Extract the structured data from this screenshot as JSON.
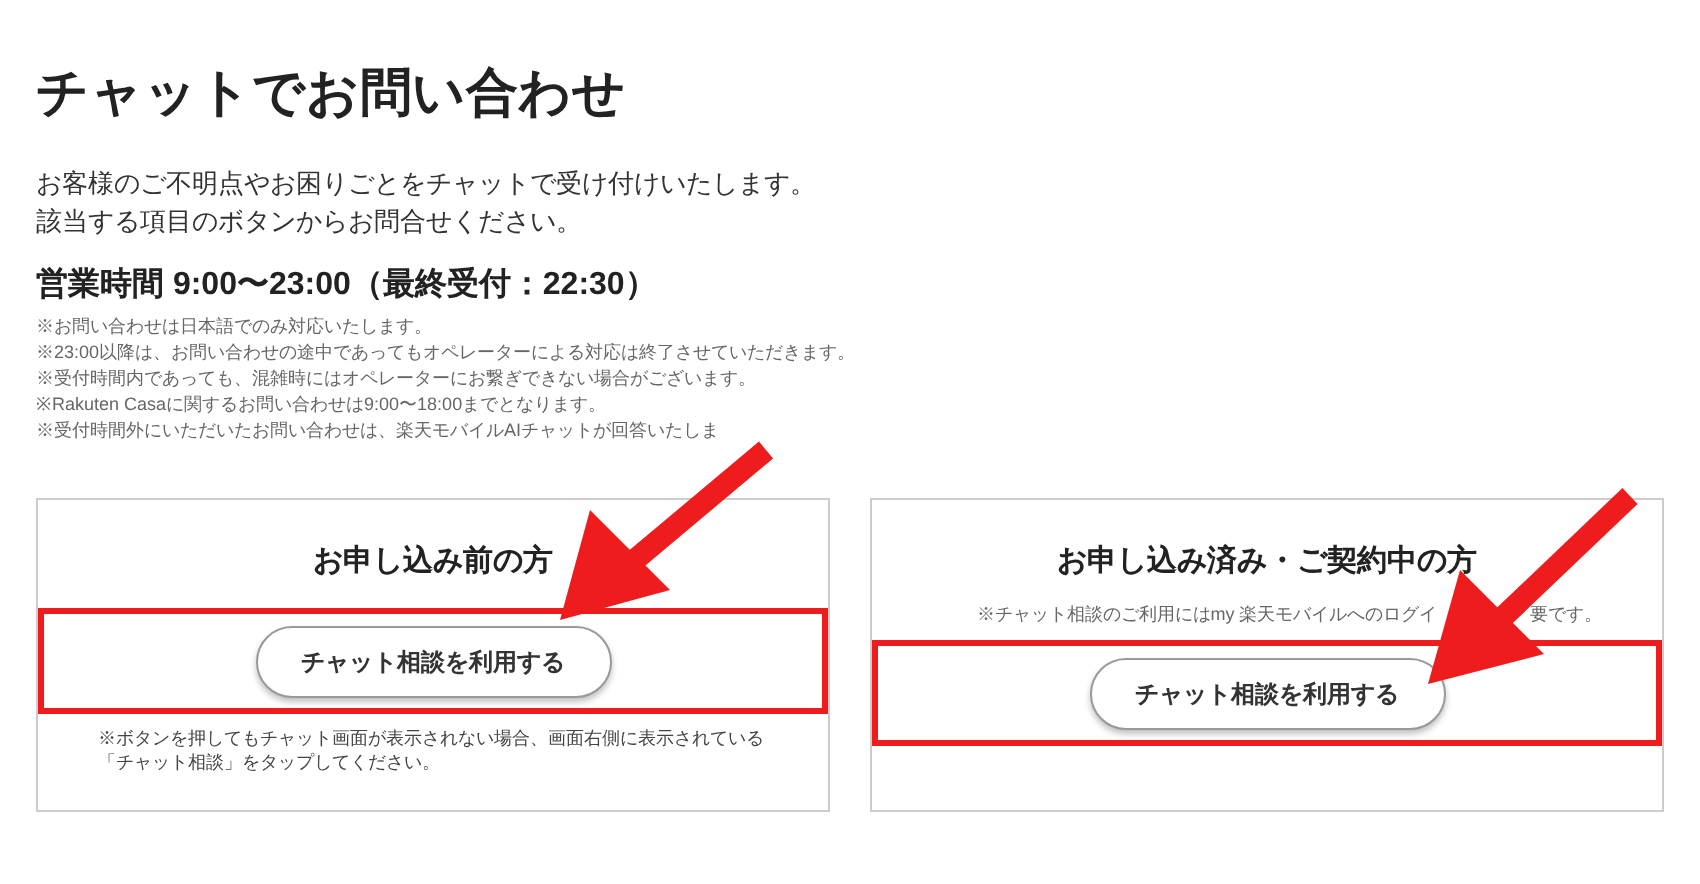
{
  "title": "チャットでお問い合わせ",
  "intro": [
    "お客様のご不明点やお困りごとをチャットで受け付けいたします。",
    "該当する項目のボタンからお問合せください。"
  ],
  "hours": "営業時間 9:00〜23:00（最終受付：22:30）",
  "notes": [
    "※お問い合わせは日本語でのみ対応いたします。",
    "※23:00以降は、お問い合わせの途中であってもオペレーターによる対応は終了させていただきます。",
    "※受付時間内であっても、混雑時にはオペレーターにお繋ぎできない場合がございます。",
    "※Rakuten Casaに関するお問い合わせは9:00〜18:00までとなります。",
    "※受付時間外にいただいたお問い合わせは、楽天モバイルAIチャットが回答いたしま"
  ],
  "cards": [
    {
      "heading": "お申し込み前の方",
      "button": "チャット相談を利用する",
      "note_after": "※ボタンを押してもチャット画面が表示されない場合、画面右側に表示されている「チャット相談」をタップしてください。"
    },
    {
      "heading": "お申し込み済み・ご契約中の方",
      "note_before": [
        "※チャット相談のご利用にはmy 楽天モバイルへのログイ",
        "要です。"
      ],
      "button": "チャット相談を利用する"
    }
  ]
}
